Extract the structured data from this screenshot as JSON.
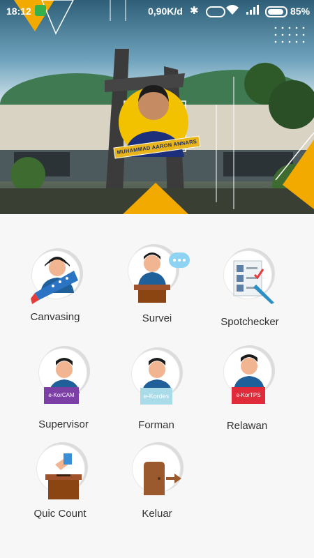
{
  "status_bar": {
    "time": "18:12",
    "speed": "0,90K/d",
    "battery": "85%"
  },
  "banner": {
    "person_name": "MUHAMMAD AARON ANNARS",
    "accent_color": "#f2a900"
  },
  "menu": {
    "canvasing": "Canvasing",
    "survei": "Survei",
    "spotchecker": "Spotchecker",
    "supervisor": "Supervisor",
    "supervisor_sign": "e-KorCAM",
    "forman": "Forman",
    "forman_sign": "e-Kordes",
    "relawan": "Relawan",
    "relawan_sign": "e-KorTPS",
    "quick_count": "Quic Count",
    "keluar": "Keluar"
  }
}
